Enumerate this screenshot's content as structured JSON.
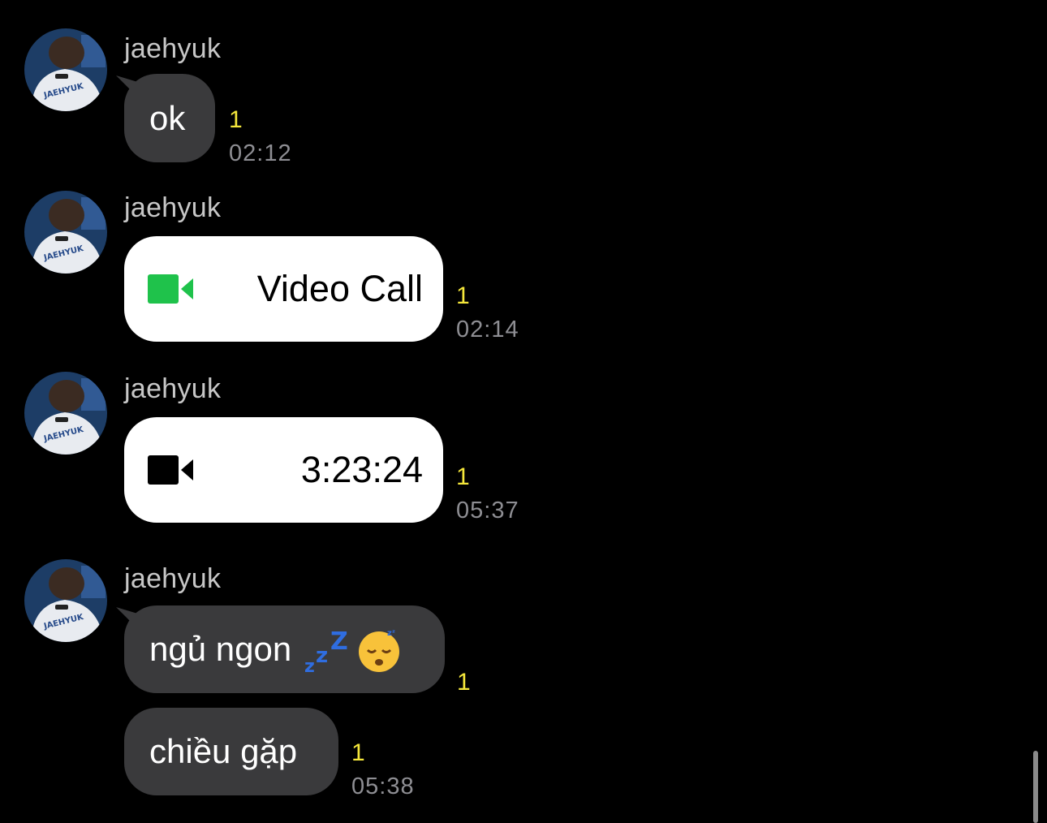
{
  "messages": [
    {
      "sender": "jaehyuk",
      "type": "text",
      "text": "ok",
      "unread": "1",
      "time": "02:12"
    },
    {
      "sender": "jaehyuk",
      "type": "call",
      "text": "Video Call",
      "unread": "1",
      "time": "02:14",
      "icon": "video-call-icon-green"
    },
    {
      "sender": "jaehyuk",
      "type": "call",
      "text": "3:23:24",
      "unread": "1",
      "time": "05:37",
      "icon": "video-call-icon-black"
    },
    {
      "sender": "jaehyuk",
      "type": "text",
      "text": "ngủ ngon",
      "unread": "1",
      "emoji": [
        "zzz-emoji",
        "sleeping-face-emoji"
      ]
    },
    {
      "sender": "",
      "type": "text",
      "text": "chiều gặp",
      "unread": "1",
      "time": "05:38"
    }
  ],
  "colors": {
    "background": "#000000",
    "bubble": "#3a3a3c",
    "call_bubble": "#ffffff",
    "unread": "#f5e73b",
    "timestamp": "#8e8e93",
    "video_icon_green": "#1fc24b"
  }
}
